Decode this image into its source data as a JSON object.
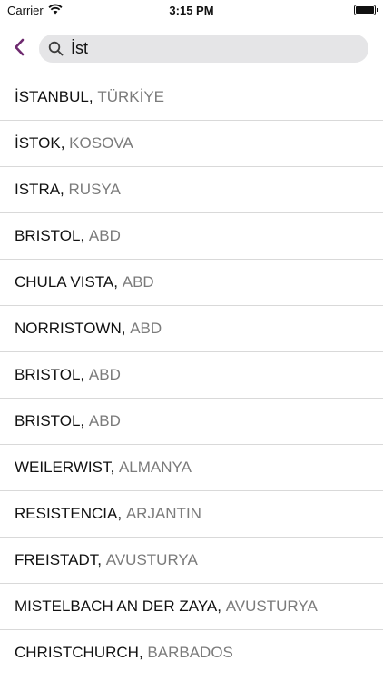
{
  "status_bar": {
    "carrier": "Carrier",
    "time": "3:15 PM"
  },
  "search": {
    "value": "İst",
    "placeholder": ""
  },
  "colors": {
    "accent": "#6e2a6f",
    "search_bg": "#e5e5e7",
    "country_text": "#7b7b7b",
    "divider": "#d9d9d9"
  },
  "results": [
    {
      "city": "İSTANBUL,",
      "country": "TÜRKİYE"
    },
    {
      "city": "İSTOK,",
      "country": "KOSOVA"
    },
    {
      "city": "ISTRA,",
      "country": "RUSYA"
    },
    {
      "city": "BRISTOL,",
      "country": "ABD"
    },
    {
      "city": "CHULA VISTA,",
      "country": "ABD"
    },
    {
      "city": "NORRISTOWN,",
      "country": "ABD"
    },
    {
      "city": "BRISTOL,",
      "country": "ABD"
    },
    {
      "city": "BRISTOL,",
      "country": "ABD"
    },
    {
      "city": "WEILERWIST,",
      "country": "ALMANYA"
    },
    {
      "city": "RESISTENCIA,",
      "country": "ARJANTIN"
    },
    {
      "city": "FREISTADT,",
      "country": "AVUSTURYA"
    },
    {
      "city": "MISTELBACH AN DER ZAYA,",
      "country": "AVUSTURYA"
    },
    {
      "city": "CHRISTCHURCH,",
      "country": "BARBADOS"
    }
  ]
}
